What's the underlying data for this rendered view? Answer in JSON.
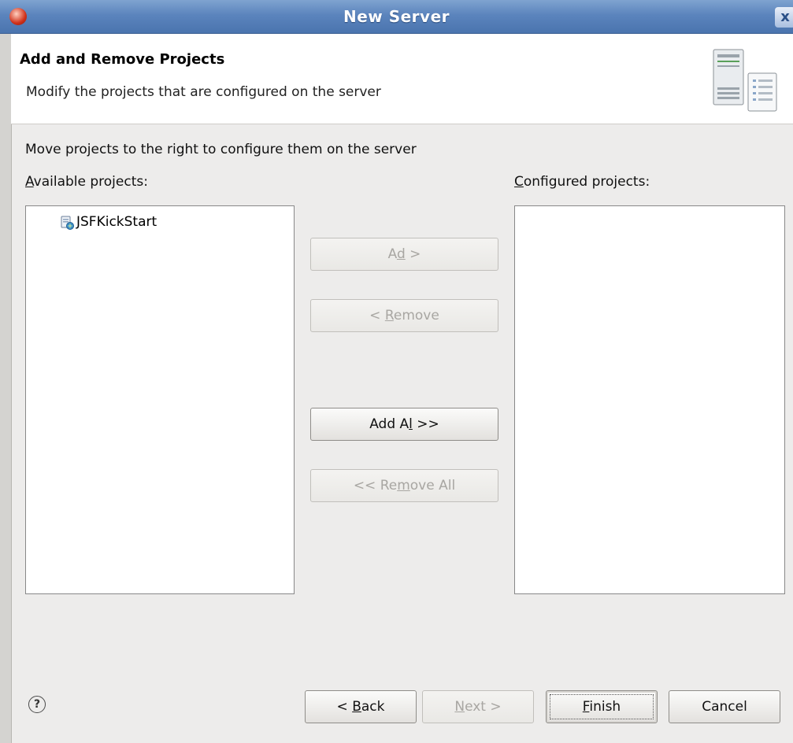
{
  "window": {
    "title": "New Server",
    "close_glyph": "x"
  },
  "header": {
    "title": "Add and Remove Projects",
    "description": "Modify the projects that are configured on the server",
    "icon": "server-banner-icon"
  },
  "body": {
    "instruction": "Move projects to the right to configure them on the server",
    "available_label": {
      "mnemonic": "A",
      "rest": "vailable projects:"
    },
    "configured_label": {
      "mnemonic": "C",
      "rest": "onfigured projects:"
    },
    "available_projects": [
      {
        "name": "JSFKickStart",
        "icon": "web-project-icon"
      }
    ],
    "configured_projects": []
  },
  "move_buttons": {
    "add": {
      "pre": "A",
      "mnemonic": "d",
      "post": "d >",
      "enabled": false
    },
    "remove": {
      "pre": "< ",
      "mnemonic": "R",
      "post": "emove",
      "enabled": false
    },
    "add_all": {
      "pre": "Add A",
      "mnemonic": "l",
      "post": "l >>",
      "enabled": true
    },
    "remove_all": {
      "pre": "<< Re",
      "mnemonic": "m",
      "post": "ove All",
      "enabled": false
    }
  },
  "footer": {
    "help_glyph": "?",
    "back": {
      "pre": "< ",
      "mnemonic": "B",
      "post": "ack",
      "enabled": true
    },
    "next": {
      "pre": "",
      "mnemonic": "N",
      "post": "ext >",
      "enabled": false
    },
    "finish": {
      "pre": "",
      "mnemonic": "F",
      "post": "inish",
      "enabled": true,
      "default": true
    },
    "cancel": {
      "label": "Cancel",
      "enabled": true
    }
  },
  "colors": {
    "titlebar": "#5b84bd",
    "dialog_bg": "#edeceb",
    "disabled_text": "#a8a6a2"
  }
}
